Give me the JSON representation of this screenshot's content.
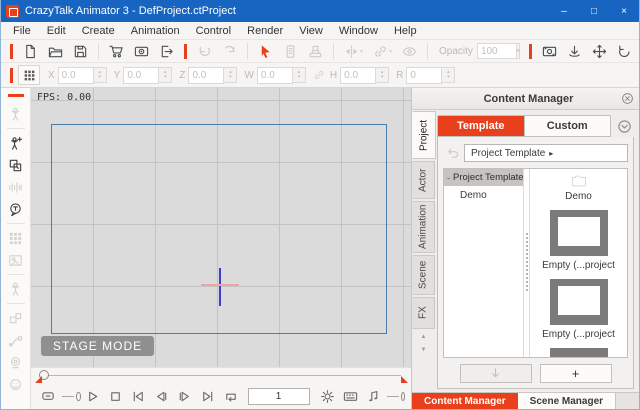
{
  "window": {
    "title": "CrazyTalk Animator 3  - DefProject.ctProject",
    "controls": {
      "minimize": "–",
      "maximize": "□",
      "close": "×"
    }
  },
  "menu": {
    "items": [
      "File",
      "Edit",
      "Create",
      "Animation",
      "Control",
      "Render",
      "View",
      "Window",
      "Help"
    ]
  },
  "toolbar": {
    "opacity": {
      "label": "Opacity",
      "value": "100"
    },
    "icons": [
      "new-project",
      "open-project",
      "save-project",
      "content-store",
      "render-preview",
      "export",
      "undo",
      "redo",
      "select-tool",
      "copy",
      "paste",
      "flip",
      "link",
      "visibility",
      "opacity-field",
      "camera-view",
      "anchor",
      "pan",
      "rotate",
      "home",
      "curtain"
    ]
  },
  "transform": {
    "icon": "transform-grid",
    "fields": [
      {
        "label": "X",
        "value": "0.0"
      },
      {
        "label": "Y",
        "value": "0.0"
      },
      {
        "label": "Z",
        "value": "0.0"
      },
      {
        "label": "W",
        "value": "0.0"
      },
      {
        "label": "H",
        "value": "0.0"
      },
      {
        "label": "R",
        "value": "0"
      }
    ]
  },
  "sidebar": {
    "icons": [
      "actor",
      "create-actor",
      "composer",
      "motion",
      "text-bubble",
      "props",
      "image-frame",
      "character",
      "shapes",
      "motion-path",
      "webcam",
      "face-puppet"
    ]
  },
  "stage": {
    "fps_label": "FPS: 0.00",
    "mode_label": "STAGE MODE"
  },
  "playback": {
    "frame_value": "1",
    "icons": [
      "collapse-bubble",
      "play",
      "stop",
      "first-frame",
      "previous-frame",
      "next-frame",
      "last-frame",
      "loop",
      "settings-gear",
      "hotkey-panel",
      "audio-note"
    ]
  },
  "content_manager": {
    "title": "Content Manager",
    "tabs": {
      "template": "Template",
      "custom": "Custom"
    },
    "side_tabs": [
      "Project",
      "Actor",
      "Animation",
      "Scene",
      "FX"
    ],
    "breadcrumb": "Project Template",
    "breadcrumb_arrow": "▸",
    "tree": {
      "root": "Project Template",
      "collapse_glyph": "-",
      "items": [
        "Demo"
      ]
    },
    "items": [
      {
        "label": "Demo",
        "type": "folder"
      },
      {
        "label": "Empty (...project",
        "type": "project"
      },
      {
        "label": "Empty (...project",
        "type": "project"
      }
    ],
    "buttons": {
      "add": "+"
    },
    "bottom_tabs": [
      "Content Manager",
      "Scene Manager"
    ]
  },
  "glyphs": {
    "caret": "▾",
    "spin_up": "▴",
    "spin_down": "▾",
    "scroll_up": "▲",
    "scroll_down": "▼"
  },
  "colors": {
    "accent": "#e8401c",
    "titlebar": "#1765c1",
    "stage_border": "#4a7dab"
  }
}
